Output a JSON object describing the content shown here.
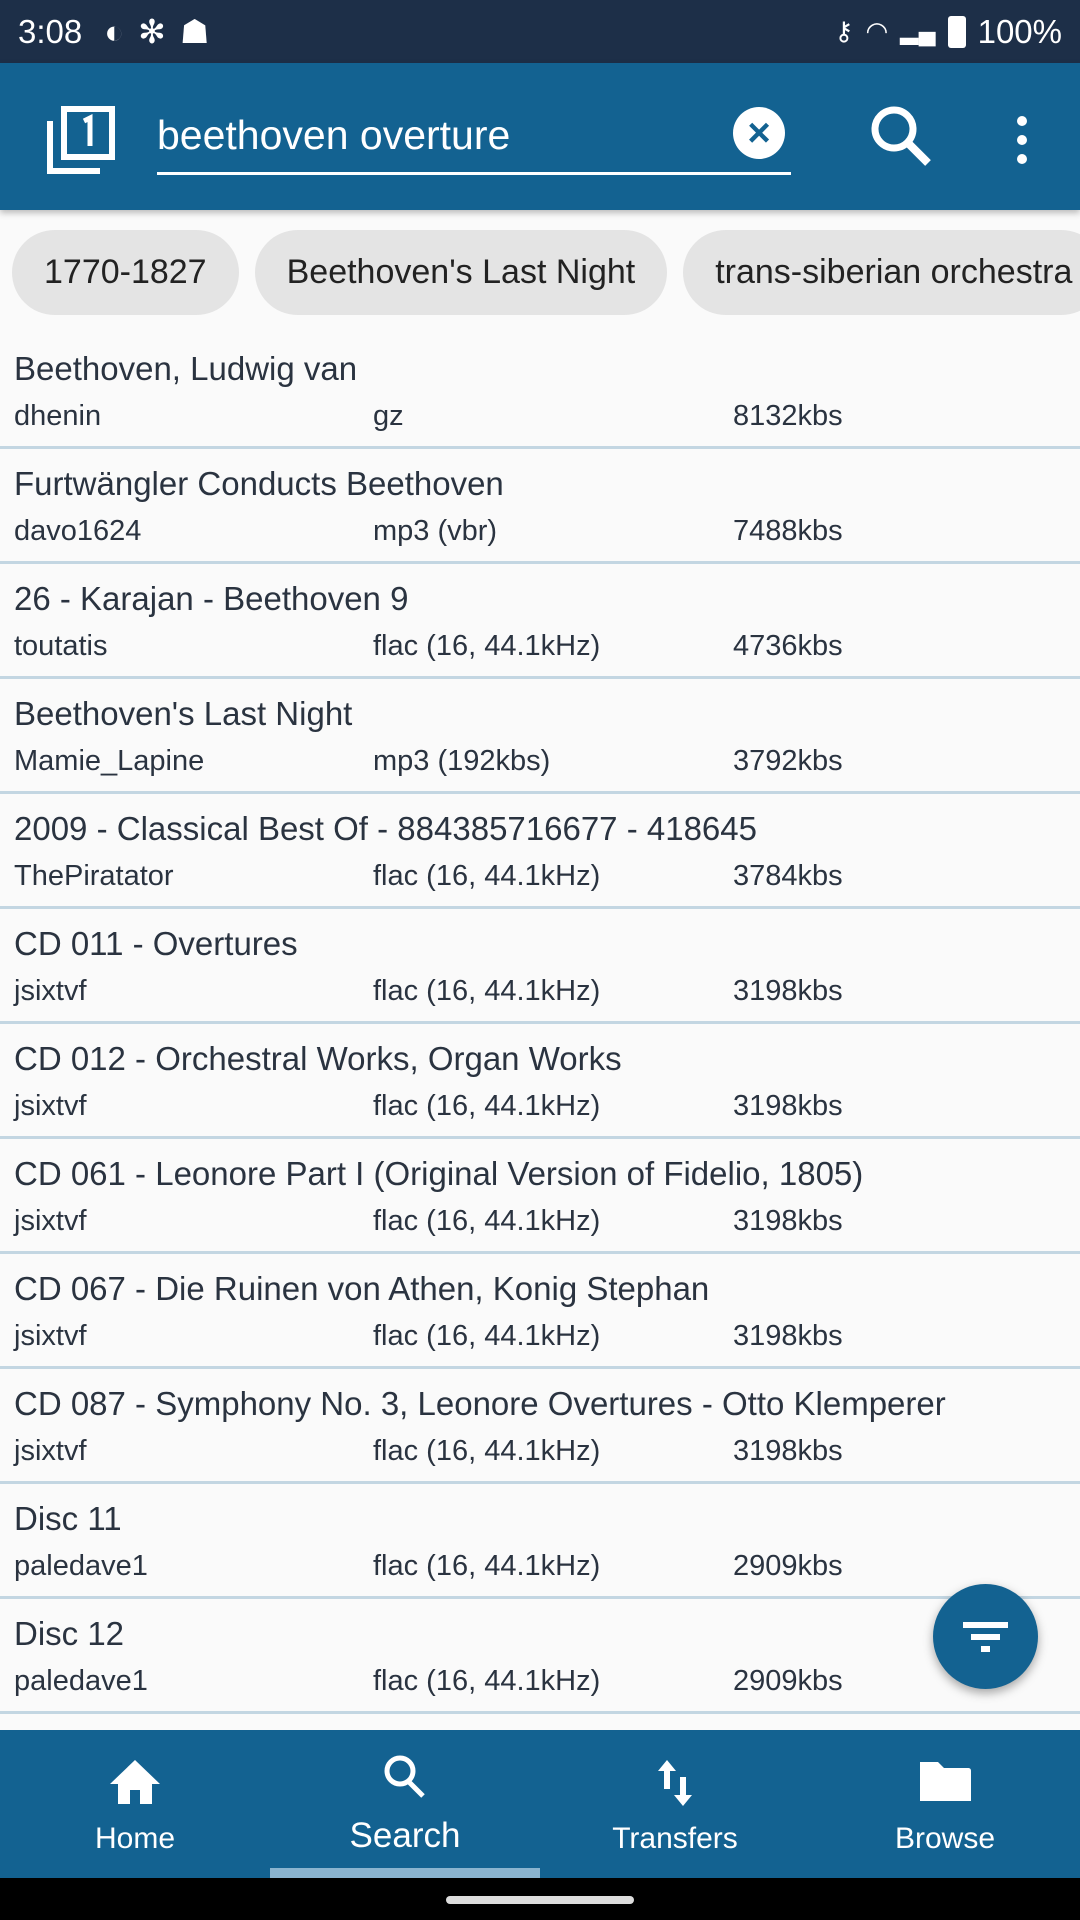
{
  "status_bar": {
    "time": "3:08",
    "battery": "100%",
    "icons": [
      "notification-app-icon",
      "settings-gear-icon",
      "ghost-icon",
      "vpn-key-icon",
      "wifi-icon",
      "signal-icon",
      "battery-charging-icon"
    ]
  },
  "app_bar": {
    "query": "beethoven overture",
    "icons": [
      "tabs-icon",
      "clear-icon",
      "search-icon",
      "more-vert-icon"
    ]
  },
  "chips": [
    "1770-1827",
    "Beethoven's Last Night",
    "trans-siberian orchestra"
  ],
  "results": [
    {
      "title": "Beethoven, Ludwig van",
      "user": "dhenin",
      "format": "gz",
      "speed": "8132kbs"
    },
    {
      "title": "Furtwängler Conducts Beethoven",
      "user": "davo1624",
      "format": "mp3 (vbr)",
      "speed": "7488kbs"
    },
    {
      "title": "26 - Karajan - Beethoven 9",
      "user": "toutatis",
      "format": "flac (16, 44.1kHz)",
      "speed": "4736kbs"
    },
    {
      "title": "Beethoven's Last Night",
      "user": "Mamie_Lapine",
      "format": "mp3 (192kbs)",
      "speed": "3792kbs"
    },
    {
      "title": "2009 - Classical Best Of - 884385716677 - 418645",
      "user": "ThePiratator",
      "format": "flac (16, 44.1kHz)",
      "speed": "3784kbs"
    },
    {
      "title": "CD 011 - Overtures",
      "user": "jsixtvf",
      "format": "flac (16, 44.1kHz)",
      "speed": "3198kbs"
    },
    {
      "title": "CD 012 - Orchestral Works, Organ Works",
      "user": "jsixtvf",
      "format": "flac (16, 44.1kHz)",
      "speed": "3198kbs"
    },
    {
      "title": "CD 061 - Leonore Part I (Original Version of Fidelio, 1805)",
      "user": "jsixtvf",
      "format": "flac (16, 44.1kHz)",
      "speed": "3198kbs"
    },
    {
      "title": "CD 067 - Die Ruinen von Athen, Konig Stephan",
      "user": "jsixtvf",
      "format": "flac (16, 44.1kHz)",
      "speed": "3198kbs"
    },
    {
      "title": "CD 087 - Symphony No. 3, Leonore Overtures - Otto Klemperer",
      "user": "jsixtvf",
      "format": "flac (16, 44.1kHz)",
      "speed": "3198kbs"
    },
    {
      "title": "Disc 11",
      "user": "paledave1",
      "format": "flac (16, 44.1kHz)",
      "speed": "2909kbs"
    },
    {
      "title": "Disc 12",
      "user": "paledave1",
      "format": "flac (16, 44.1kHz)",
      "speed": "2909kbs"
    }
  ],
  "fab": {
    "icon": "filter-icon"
  },
  "bottom_nav": {
    "items": [
      {
        "label": "Home",
        "icon": "home-icon"
      },
      {
        "label": "Search",
        "icon": "search-icon"
      },
      {
        "label": "Transfers",
        "icon": "transfers-icon"
      },
      {
        "label": "Browse",
        "icon": "folder-icon"
      }
    ],
    "active": "Search"
  },
  "colors": {
    "primary": "#136291",
    "status_bar": "#1d2f48",
    "divider": "#c3d6e2",
    "indicator": "#8ab4cf"
  }
}
